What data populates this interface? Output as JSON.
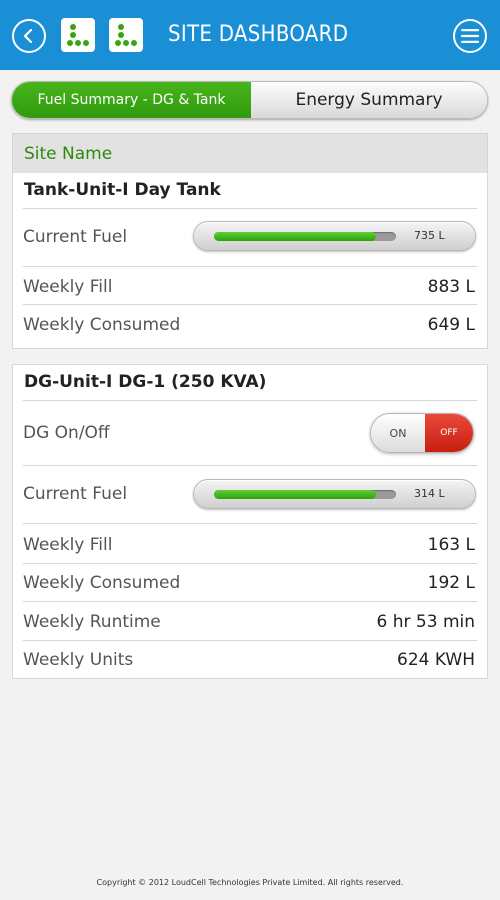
{
  "header": {
    "title": "SITE DASHBOARD",
    "icons": [
      "back-arrow-icon",
      "site-logo-icon",
      "site-logo-icon",
      "hamburger-menu-icon"
    ],
    "color": "#1a8fd6"
  },
  "tabs": [
    {
      "label": "Fuel Summary - DG & Tank",
      "active": true
    },
    {
      "label": "Energy Summary",
      "active": false
    }
  ],
  "site": {
    "label": "Site Name"
  },
  "tank": {
    "title": "Tank-Unit-I Day Tank",
    "current_fuel_label": "Current Fuel",
    "current_fuel_value": "735 L",
    "current_fuel_level": 0.89,
    "weekly_fill_label": "Weekly Fill",
    "weekly_fill_value": "883 L",
    "weekly_consumed_label": "Weekly Consumed",
    "weekly_consumed_value": "649 L"
  },
  "dg": {
    "title": "DG-Unit-I DG-1 (250 KVA)",
    "onoff_label": "DG On/Off",
    "toggle_on": "ON",
    "toggle_off": "OFF",
    "toggle_state": "OFF",
    "current_fuel_label": "Current Fuel",
    "current_fuel_value": "314 L",
    "current_fuel_level": 0.89,
    "weekly_fill_label": "Weekly Fill",
    "weekly_fill_value": "163 L",
    "weekly_consumed_label": "Weekly Consumed",
    "weekly_consumed_value": "192 L",
    "weekly_runtime_label": "Weekly Runtime",
    "weekly_runtime_value": "6 hr 53 min",
    "weekly_units_label": "Weekly Units",
    "weekly_units_value": "624 KWH"
  },
  "colors": {
    "accent": "#1a8fd6",
    "active_tab": "#3aa513",
    "off_red": "#d62a1a",
    "fuel_green": "#3cb016"
  },
  "footer": {
    "copyright": "Copyright © 2012 LoudCell Technologies Private Limited. All rights reserved."
  }
}
